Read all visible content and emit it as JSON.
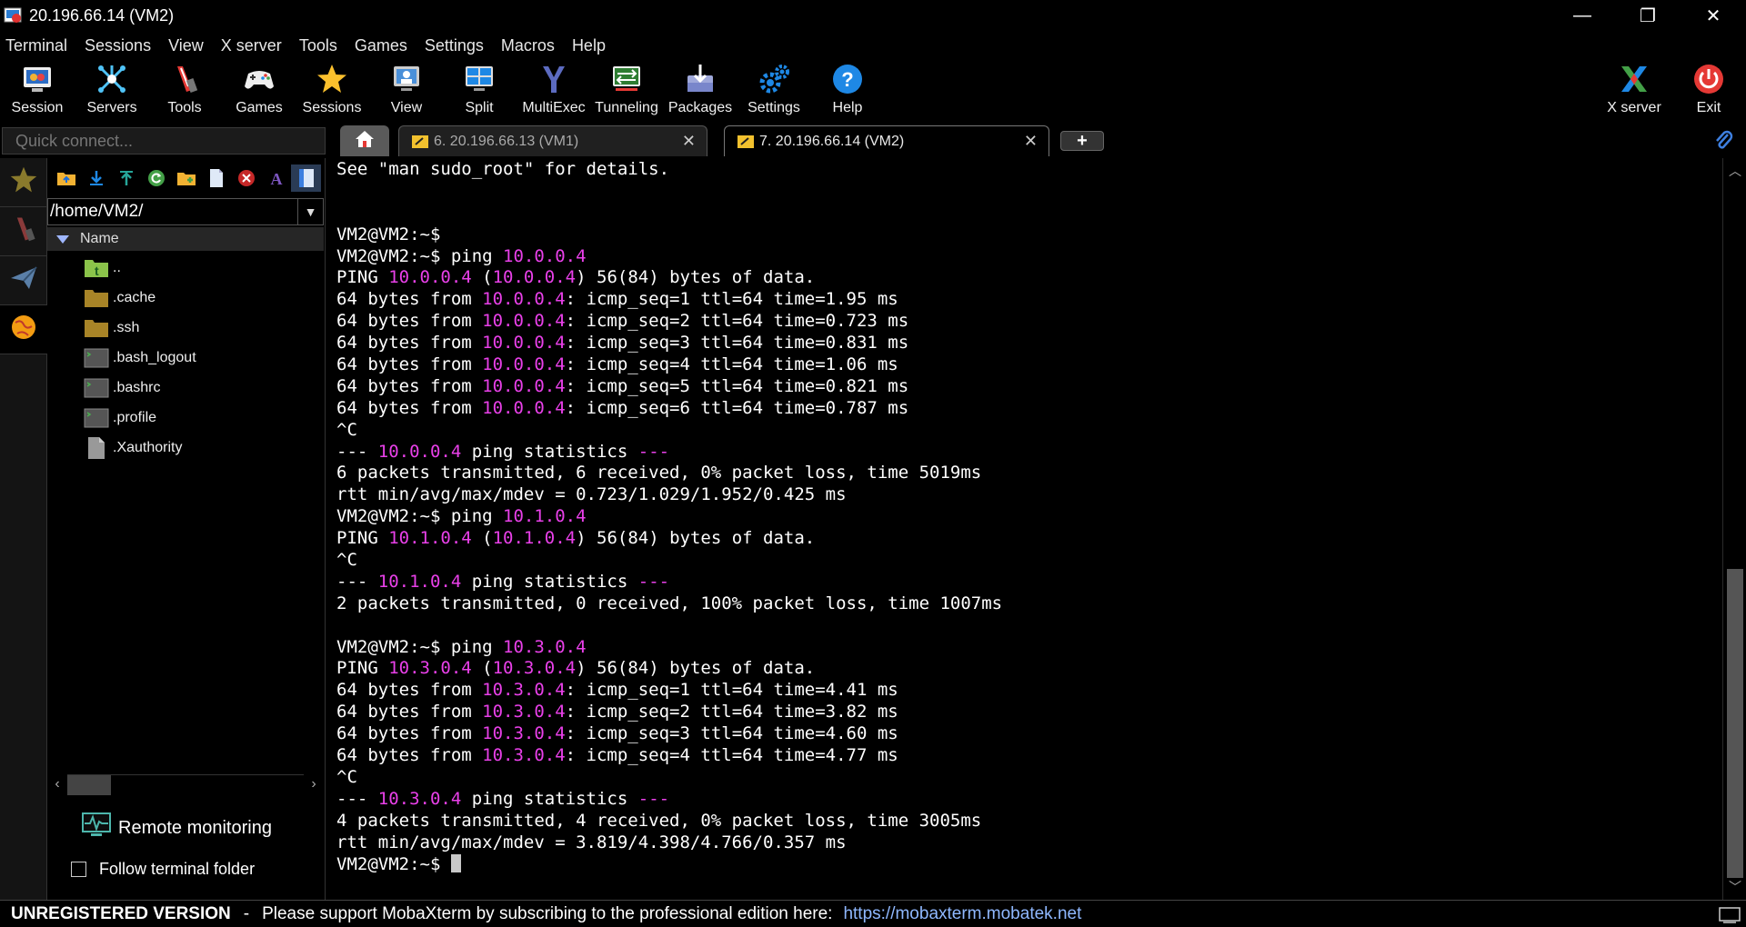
{
  "window": {
    "title": "20.196.66.14 (VM2)",
    "minimize": "—",
    "restore": "❐",
    "close": "✕"
  },
  "menu": [
    "Terminal",
    "Sessions",
    "View",
    "X server",
    "Tools",
    "Games",
    "Settings",
    "Macros",
    "Help"
  ],
  "toolbar": {
    "session": "Session",
    "servers": "Servers",
    "tools": "Tools",
    "games": "Games",
    "sessions": "Sessions",
    "view": "View",
    "split": "Split",
    "multiexec": "MultiExec",
    "tunneling": "Tunneling",
    "packages": "Packages",
    "settings": "Settings",
    "help": "Help",
    "xserver": "X server",
    "exit": "Exit"
  },
  "quick_connect": {
    "placeholder": "Quick connect..."
  },
  "tabs": [
    {
      "label": "6. 20.196.66.13 (VM1)",
      "active": false
    },
    {
      "label": "7. 20.196.66.14 (VM2)",
      "active": true
    }
  ],
  "sidebar": {
    "path": "/home/VM2/",
    "column_header": "Name",
    "files": [
      "..",
      ".cache",
      ".ssh",
      ".bash_logout",
      ".bashrc",
      ".profile",
      ".Xauthority"
    ],
    "remote_monitoring": "Remote monitoring",
    "follow_terminal_folder": "Follow terminal folder"
  },
  "terminal": {
    "l01": "See \"man sudo_root\" for details.",
    "prompt": "VM2@VM2:~$",
    "ping_cmd": " ping ",
    "ip1": "10.0.0.4",
    "ip2": "10.1.0.4",
    "ip3": "10.3.0.4",
    "ping_hdr_pre": "PING ",
    "ping_hdr_mid": " (",
    "ping_hdr_post": ") 56(84) bytes of data.",
    "bytes_from": "64 bytes from ",
    "r1_1": ": icmp_seq=1 ttl=64 time=1.95 ms",
    "r1_2": ": icmp_seq=2 ttl=64 time=0.723 ms",
    "r1_3": ": icmp_seq=3 ttl=64 time=0.831 ms",
    "r1_4": ": icmp_seq=4 ttl=64 time=1.06 ms",
    "r1_5": ": icmp_seq=5 ttl=64 time=0.821 ms",
    "r1_6": ": icmp_seq=6 ttl=64 time=0.787 ms",
    "ctrl_c": "^C",
    "stat_pre": "--- ",
    "stat_post": " ping statistics ",
    "stat_dash": "---",
    "sum1": "6 packets transmitted, 6 received, 0% packet loss, time 5019ms",
    "rtt1": "rtt min/avg/max/mdev = 0.723/1.029/1.952/0.425 ms",
    "sum2": "2 packets transmitted, 0 received, 100% packet loss, time 1007ms",
    "r3_1": ": icmp_seq=1 ttl=64 time=4.41 ms",
    "r3_2": ": icmp_seq=2 ttl=64 time=3.82 ms",
    "r3_3": ": icmp_seq=3 ttl=64 time=4.60 ms",
    "r3_4": ": icmp_seq=4 ttl=64 time=4.77 ms",
    "sum3": "4 packets transmitted, 4 received, 0% packet loss, time 3005ms",
    "rtt3": "rtt min/avg/max/mdev = 3.819/4.398/4.766/0.357 ms"
  },
  "status": {
    "unregistered": "UNREGISTERED VERSION",
    "sep": "-",
    "message": "Please support MobaXterm by subscribing to the professional edition here:",
    "link": "https://mobaxterm.mobatek.net"
  },
  "colors": {
    "ip_highlight": "#e940e9",
    "link": "#8fb8ff"
  }
}
